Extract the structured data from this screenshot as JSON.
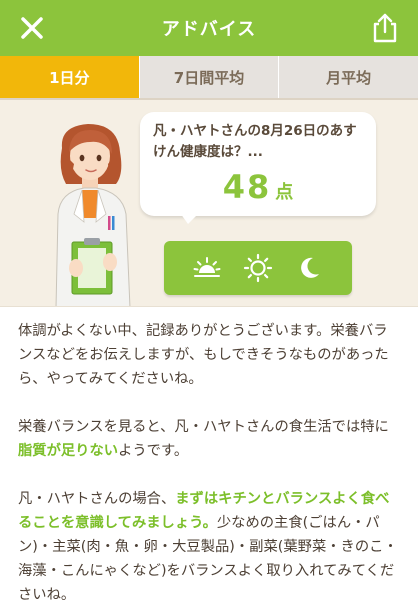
{
  "header": {
    "title": "アドバイス",
    "close_icon": "close-icon",
    "share_icon": "share-icon",
    "color": "#8cc43c"
  },
  "tabs": [
    {
      "label": "1日分",
      "active": true
    },
    {
      "label": "7日間平均",
      "active": false
    },
    {
      "label": "月平均",
      "active": false
    }
  ],
  "bubble": {
    "text": "凡・ハヤトさんの8月26日のあすけん健康度は？...",
    "score": "48",
    "score_unit": "点"
  },
  "time_icons": [
    "sunrise-icon",
    "sun-icon",
    "moon-icon"
  ],
  "advice": {
    "p1": "体調がよくない中、記録ありがとうございます。栄養バランスなどをお伝えしますが、もしできそうなものがあったら、やってみてくださいね。",
    "p2_before": "栄養バランスを見ると、凡・ハヤトさんの食生活では特に",
    "p2_highlight": "脂質が足りない",
    "p2_after": "ようです。",
    "p3_before": "凡・ハヤトさんの場合、",
    "p3_highlight": "まずはキチンとバランスよく食べることを意識してみましょう。",
    "p3_after": "少なめの主食(ごはん・パン)・主菜(肉・魚・卵・大豆製品)・副菜(葉野菜・きのこ・海藻・こんにゃくなど)をバランスよく取り入れてみてくださいね。"
  },
  "colors": {
    "accent": "#8cc43c",
    "active_tab": "#f2b70a",
    "highlight": "#7cbf2a"
  }
}
